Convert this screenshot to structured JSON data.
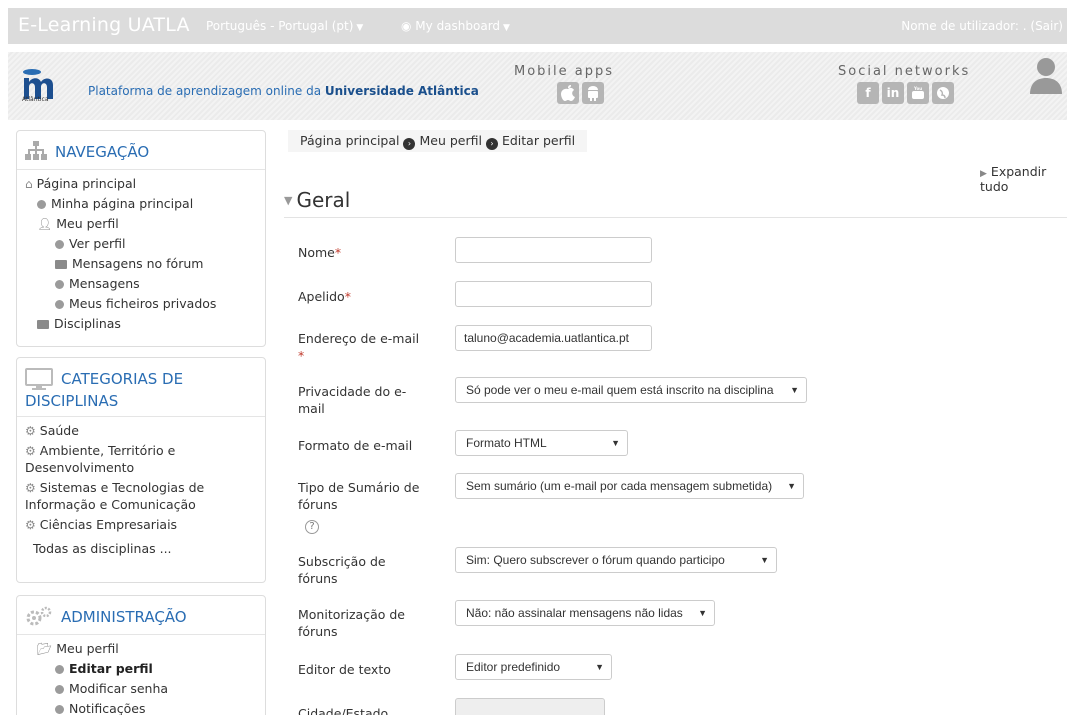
{
  "navbar": {
    "brand": "E-Learning UATLA",
    "language": "Português - Portugal (pt)",
    "dashboard": "My dashboard",
    "user": "Nome de utilizador: . (Sair)"
  },
  "header": {
    "logo_subtext": "Atlântica",
    "tagline_prefix": "Plataforma de aprendizagem online da ",
    "tagline_bold": "Universidade Atlântica",
    "mobile_apps_title": "Mobile apps",
    "mobile_icons": [
      "apple-icon",
      "android-icon"
    ],
    "social_title": "Social networks",
    "social_icons": [
      "facebook-icon",
      "linkedin-icon",
      "youtube-icon",
      "globe-icon"
    ]
  },
  "navigation": {
    "title": "NAVEGAÇÃO",
    "home": "Página principal",
    "my_home": "Minha página principal",
    "my_profile": "Meu perfil",
    "view_profile": "Ver perfil",
    "forum_posts": "Mensagens no fórum",
    "messages": "Mensagens",
    "private_files": "Meus ficheiros privados",
    "courses": "Disciplinas"
  },
  "categories": {
    "title_line1": "CATEGORIAS DE",
    "title_line2": "DISCIPLINAS",
    "items": [
      "Saúde",
      "Ambiente, Território e",
      "Desenvolvimento",
      "Sistemas e Tecnologias de",
      "Informação e Comunicação",
      "Ciências Empresariais"
    ],
    "all": "Todas as disciplinas ..."
  },
  "admin": {
    "title": "ADMINISTRAÇÃO",
    "my_profile": "Meu perfil",
    "edit_profile": "Editar perfil",
    "change_password": "Modificar senha",
    "notifications": "Notificações"
  },
  "breadcrumb": [
    "Página principal",
    "Meu perfil",
    "Editar perfil"
  ],
  "expand_all": "Expandir tudo",
  "section_title": "Geral",
  "form": {
    "name_label": "Nome",
    "surname_label": "Apelido",
    "email_label": "Endereço de e-mail",
    "email_value": "taluno@academia.uatlantica.pt",
    "privacy_label_1": "Privacidade do e-",
    "privacy_label_2": "mail",
    "privacy_value": "Só pode ver o meu e-mail quem está inscrito na disciplina",
    "format_label": "Formato de e-mail",
    "format_value": "Formato HTML",
    "digest_label_1": "Tipo de Sumário de",
    "digest_label_2": "fóruns",
    "digest_value": "Sem sumário (um e-mail por cada mensagem submetida)",
    "subscribe_label_1": "Subscrição de",
    "subscribe_label_2": "fóruns",
    "subscribe_value": "Sim: Quero subscrever o fórum quando participo",
    "tracking_label_1": "Monitorização de",
    "tracking_label_2": "fóruns",
    "tracking_value": "Não: não assinalar mensagens não lidas",
    "editor_label": "Editor de texto",
    "editor_value": "Editor predefinido",
    "city_label": "Cidade/Estado",
    "required_mark": "*",
    "help_glyph": "?"
  }
}
